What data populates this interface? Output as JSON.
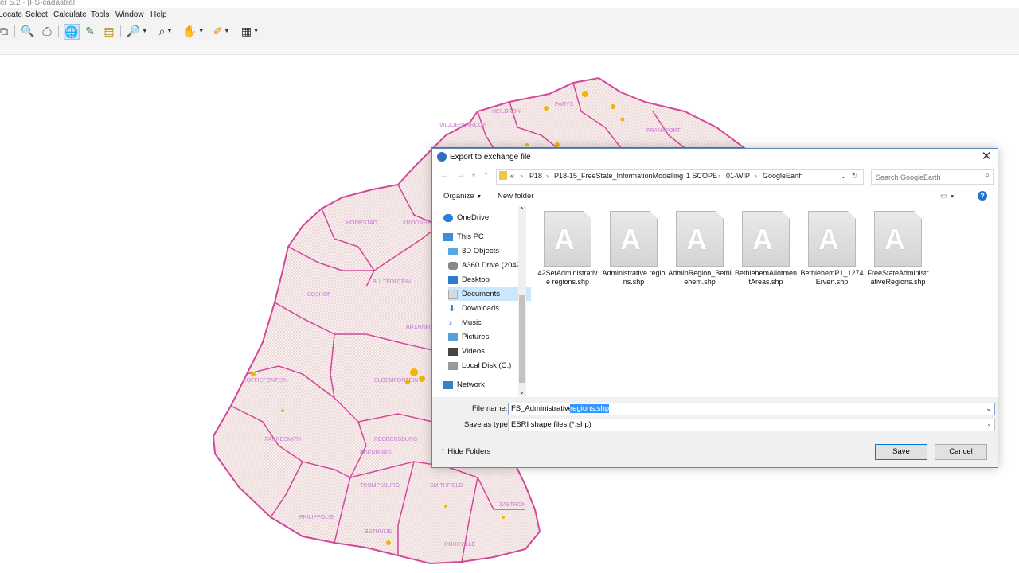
{
  "app": {
    "title": "er 5.2 - [FS-cadastral]"
  },
  "menu": [
    "Locate",
    "Select",
    "Calculate",
    "Tools",
    "Window",
    "Help"
  ],
  "map_labels": [
    "PARYS",
    "HEILBRON",
    "VILJOENSKROON",
    "FRANKFORT",
    "HOOPSTAD",
    "BULTFONTEIN",
    "BOSHOF",
    "BLOEMFONTEIN",
    "KOFFIEFONTEIN",
    "FAURESMITH",
    "REDDERSBURG",
    "EDENBURG",
    "TROMPSBURG",
    "SMITHFIELD",
    "ZASTRON",
    "PHILIPPOLIS",
    "BETHULIE",
    "ROUXVILLE",
    "KROONSTAD",
    "BRANDFORT"
  ],
  "dialog": {
    "title": "Export to exchange file",
    "breadcrumb": [
      "«",
      "P18",
      "P18-15_FreeState_InformationModelling",
      "1 SCOPE",
      "01-WIP",
      "GoogleEarth"
    ],
    "search_placeholder": "Search GoogleEarth",
    "organize": "Organize",
    "new_folder": "New folder",
    "nav": [
      {
        "label": "OneDrive"
      },
      {
        "label": "This PC"
      },
      {
        "label": "3D Objects"
      },
      {
        "label": "A360 Drive (2042"
      },
      {
        "label": "Desktop"
      },
      {
        "label": "Documents"
      },
      {
        "label": "Downloads"
      },
      {
        "label": "Music"
      },
      {
        "label": "Pictures"
      },
      {
        "label": "Videos"
      },
      {
        "label": "Local Disk (C:)"
      },
      {
        "label": "Network"
      }
    ],
    "files": [
      "42SetAdministrative regions.shp",
      "Administrative regions.shp",
      "AdminRegion_Bethlehem.shp",
      "BethlehemAllotmentAreas.shp",
      "BethlehemP1_1274Erven.shp",
      "FreeStateAdministrativeRegions.shp"
    ],
    "file_name_label": "File name:",
    "file_name_value_plain": "FS_Administrative ",
    "file_name_value_selected": "regions.shp",
    "save_type_label": "Save as type:",
    "save_type_value": "ESRI shape files (*.shp)",
    "hide_folders": "Hide Folders",
    "save": "Save",
    "cancel": "Cancel"
  },
  "colors": {
    "boundary": "#d4489a",
    "map_fill": "#f3e6e6",
    "label": "#c77bd0",
    "highlight": "#f2b500",
    "selection": "#3399ff"
  }
}
